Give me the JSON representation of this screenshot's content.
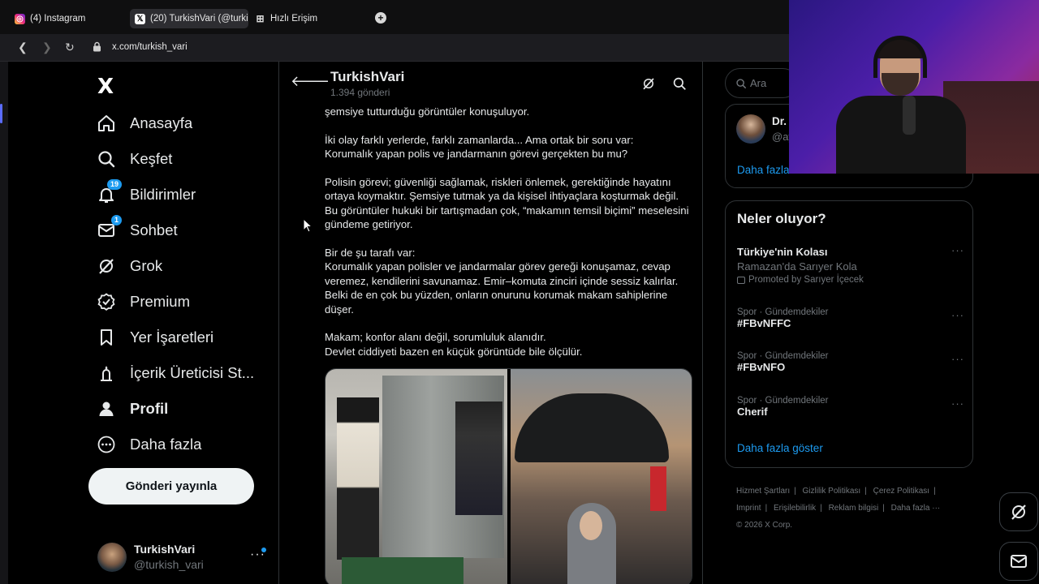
{
  "browser": {
    "tabs": [
      {
        "label": "(4) Instagram",
        "icon": "instagram-icon"
      },
      {
        "label": "(20) TurkishVari (@turkish",
        "icon": "x-icon",
        "active": true
      },
      {
        "label": "Hızlı Erişim",
        "icon": "grid-icon"
      }
    ],
    "url": "x.com/turkish_vari"
  },
  "sidebar": {
    "logo": "X",
    "items": [
      {
        "label": "Anasayfa",
        "icon": "home-icon"
      },
      {
        "label": "Keşfet",
        "icon": "search-icon"
      },
      {
        "label": "Bildirimler",
        "icon": "bell-icon",
        "badge": "19"
      },
      {
        "label": "Sohbet",
        "icon": "mail-icon",
        "badge": "1"
      },
      {
        "label": "Grok",
        "icon": "grok-icon"
      },
      {
        "label": "Premium",
        "icon": "verified-icon"
      },
      {
        "label": "Yer İşaretleri",
        "icon": "bookmark-icon"
      },
      {
        "label": "İçerik Üreticisi St...",
        "icon": "creator-icon"
      },
      {
        "label": "Profil",
        "icon": "profile-icon"
      },
      {
        "label": "Daha fazla",
        "icon": "more-icon"
      }
    ],
    "post_button": "Gönderi yayınla",
    "account": {
      "name": "TurkishVari",
      "handle": "@turkish_vari",
      "more": "···"
    }
  },
  "main": {
    "title": "TurkishVari",
    "post_count": "1.394 gönderi",
    "tweet_paragraphs": [
      "şemsiye tutturduğu görüntüler konuşuluyor.",
      "İki olay farklı yerlerde, farklı zamanlarda... Ama ortak bir soru var:\nKorumalık yapan polis ve jandarmanın görevi gerçekten bu mu?",
      "Polisin görevi; güvenliği sağlamak, riskleri önlemek, gerektiğinde hayatını ortaya koymaktır. Şemsiye tutmak ya da kişisel ihtiyaçlara koşturmak değil. Bu görüntüler hukuki bir tartışmadan çok, “makamın temsil biçimi” meselesini gündeme getiriyor.",
      "Bir de şu tarafı var:\nKorumalık yapan polisler ve jandarmalar görev gereği konuşamaz, cevap veremez, kendilerini savunamaz. Emir–komuta zinciri içinde sessiz kalırlar. Belki de en çok bu yüzden, onların onurunu korumak makam sahiplerine düşer.",
      "Makam; konfor alanı değil, sorumluluk alanıdır.\nDevlet ciddiyeti bazen en küçük görüntüde bile ölçülür."
    ]
  },
  "right": {
    "search_placeholder": "Ara",
    "who_to_follow": {
      "name": "Dr. ",
      "handle": "@ay",
      "more": "Daha fazla"
    },
    "trends_title": "Neler oluyor?",
    "trends": [
      {
        "name": "Türkiye'nin Kolası",
        "sub": "Ramazan'da Sarıyer Kola",
        "promo": "Promoted by Sarıyer İçecek"
      },
      {
        "meta": "Spor · Gündemdekiler",
        "name": "#FBvNFFC"
      },
      {
        "meta": "Spor · Gündemdekiler",
        "name": "#FBvNFO"
      },
      {
        "meta": "Spor · Gündemdekiler",
        "name": "Cherif"
      }
    ],
    "trends_more": "Daha fazla göster",
    "footer": [
      "Hizmet Şartları",
      "|",
      "Gizlilik Politikası",
      "|",
      "Çerez Politikası",
      "|",
      "Imprint",
      "|",
      "Erişilebilirlik",
      "|",
      "Reklam bilgisi",
      "|",
      "Daha fazla ···",
      "© 2026 X Corp."
    ]
  },
  "colors": {
    "accent": "#1d9bf0",
    "background": "#000000",
    "text": "#e7e9ea",
    "muted": "#71767b",
    "border": "#2f3336"
  }
}
